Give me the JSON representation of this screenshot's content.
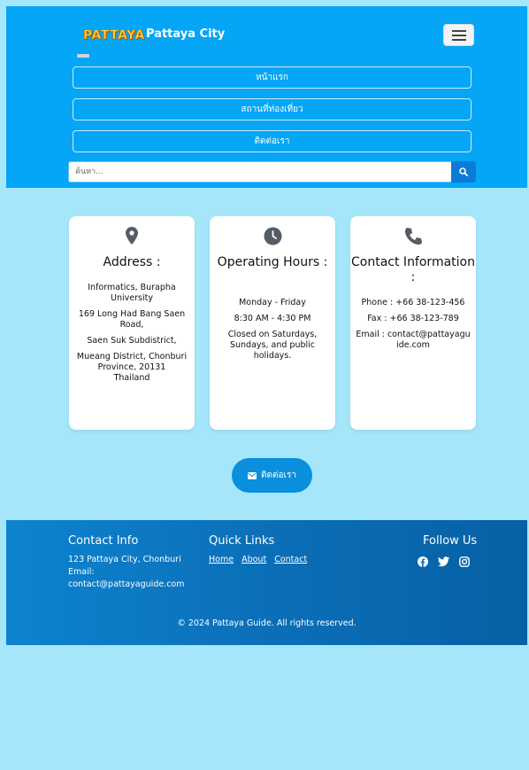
{
  "header": {
    "logo_text": "PATTAYA",
    "title": "Pattaya City",
    "menu_icon": "hamburger-icon",
    "nav": [
      "หน้าแรก",
      "สถานที่ท่องเที่ยว",
      "ติดต่อเรา"
    ],
    "search_placeholder": "ค้นหา...",
    "search_icon": "search-icon"
  },
  "cards": [
    {
      "icon": "map-pin-icon",
      "title": "Address :",
      "lines": [
        "Informatics, Burapha University",
        "169 Long Had Bang Saen Road,",
        "Saen Suk Subdistrict,",
        "Mueang District, Chonburi Province, 20131\nThailand"
      ]
    },
    {
      "icon": "clock-icon",
      "title": "Operating Hours :",
      "lines": [
        "Monday - Friday",
        "8:30 AM - 4:30 PM",
        "Closed on Saturdays, Sundays, and public holidays."
      ]
    },
    {
      "icon": "phone-icon",
      "title": "Contact Information :",
      "lines": [
        "Phone : +66 38-123-456",
        "Fax : +66 38-123-789",
        "Email : contact@pattayaguide.com"
      ]
    }
  ],
  "cta": {
    "label": "ติดต่อเรา",
    "icon": "envelope-icon"
  },
  "footer": {
    "contact_title": "Contact Info",
    "address": "123 Pattaya City, Chonburi",
    "email_label": "Email:",
    "email": "contact@pattayaguide.com",
    "links_title": "Quick Links",
    "links": [
      "Home",
      "About",
      "Contact"
    ],
    "follow_title": "Follow Us",
    "social_icons": [
      "facebook-icon",
      "twitter-icon",
      "instagram-icon"
    ],
    "copyright": "© 2024 Pattaya Guide. All rights reserved."
  },
  "colors": {
    "header_bg": "#04a6f5",
    "page_bg": "#a5e6fb",
    "accent": "#0a8fdc",
    "footer_bg": "#0b6fb8",
    "icon_gray": "#555c66"
  }
}
